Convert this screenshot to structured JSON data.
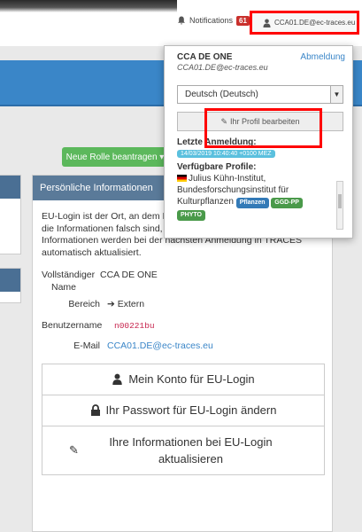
{
  "header": {
    "notifications_label": "Notifications",
    "notifications_count": "61",
    "user_label": "CCA01.DE@ec-traces.eu"
  },
  "green_button": {
    "label": "Neue Rolle beantragen ▾"
  },
  "user_popup": {
    "name": "CCA DE ONE",
    "email": "CCA01.DE@ec-traces.eu",
    "logout": "Abmeldung",
    "language": "Deutsch (Deutsch)",
    "edit_profile": "Ihr Profil bearbeiten",
    "last_login_label": "Letzte Anmeldung:",
    "last_login_value": "14/03/2019 10:40:40 +0100 MEZ",
    "profiles_label": "Verfügbare Profile:",
    "profile_text": "Julius Kühn-Institut, Bundesforschungsinstitut für Kulturpflanzen",
    "tags": [
      "Pflanzen",
      "GGD-PP",
      "PHYTO"
    ]
  },
  "panel": {
    "title": "Persönliche Informationen",
    "intro": "EU-Login ist der Ort, an dem Ihre Daten gespeichert werden. Wenn die Informationen falsch sind, können Sie sie dort aktualisieren. Ihre Informationen werden bei der nächsten Anmeldung in TRACES automatisch aktualisiert.",
    "fields": {
      "full_name_label": "Vollständiger Name",
      "full_name_value": "CCA DE ONE",
      "area_label": "Bereich",
      "area_value": "Extern",
      "username_label": "Benutzername",
      "username_value": "n00221bu",
      "email_label": "E-Mail",
      "email_value": "CCA01.DE@ec-traces.eu"
    },
    "buttons": {
      "account": "Mein Konto für EU-Login",
      "password": "Ihr Passwort für EU-Login ändern",
      "update": "Ihre Informationen bei EU-Login aktualisieren"
    }
  }
}
